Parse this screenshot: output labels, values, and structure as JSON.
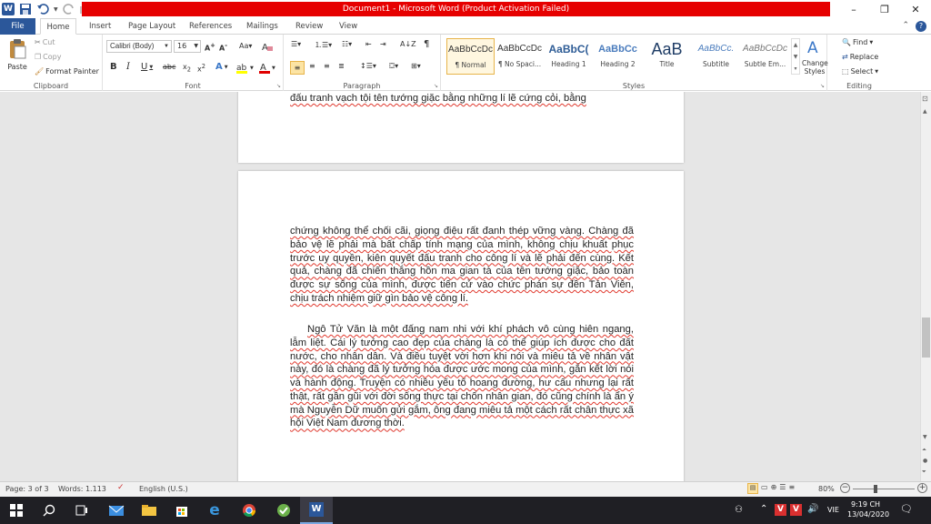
{
  "window": {
    "title": "Document1 - Microsoft Word (Product Activation Failed)",
    "minimize": "–",
    "restore": "❐",
    "close": "✕",
    "help": "?"
  },
  "tabs": [
    "File",
    "Home",
    "Insert",
    "Page Layout",
    "References",
    "Mailings",
    "Review",
    "View"
  ],
  "clipboard": {
    "paste": "Paste",
    "cut": "Cut",
    "copy": "Copy",
    "format_painter": "Format Painter",
    "label": "Clipboard"
  },
  "font": {
    "name": "Calibri (Body)",
    "size": "16",
    "label": "Font"
  },
  "paragraph": {
    "label": "Paragraph"
  },
  "styles": {
    "label": "Styles",
    "items": [
      {
        "preview": "AaBbCcDc",
        "name": "¶ Normal"
      },
      {
        "preview": "AaBbCcDc",
        "name": "¶ No Spaci..."
      },
      {
        "preview": "AaBbC(",
        "name": "Heading 1"
      },
      {
        "preview": "AaBbCc",
        "name": "Heading 2"
      },
      {
        "preview": "AaB",
        "name": "Title"
      },
      {
        "preview": "AaBbCc.",
        "name": "Subtitle"
      },
      {
        "preview": "AaBbCcDc",
        "name": "Subtle Em..."
      }
    ],
    "change_styles": "Change Styles"
  },
  "editing": {
    "find": "Find",
    "replace": "Replace",
    "select": "Select",
    "label": "Editing"
  },
  "document": {
    "page1_tail": "đấu tranh vạch tội tên tướng giặc bằng những lí lẽ cứng cỏi, bằng",
    "p1": "chứng không thể chối cãi, giọng điệu rất đanh thép vững vàng. Chàng đã bảo vệ lẽ phải mà bất chấp tính mạng của mình, không chịu khuất phục trước uy quyền, kiên quyết đấu tranh cho công lí và lẽ phải đến cùng. Kết quả, chàng đã chiến thắng hồn ma gian tà của tên tướng giặc, bảo toàn được sự sống của mình, được tiến cử vào chức phán sự đền Tản Viên, chịu trách nhiệm giữ gìn bảo vệ công lí.",
    "p2": "Ngô Tử Văn là một đấng nam nhi với khí phách vô cùng hiên ngang, lẫm liệt. Cái lý tưởng cao đẹp của chàng là có thể giúp ích được cho đất nước, cho nhân dân. Và điều tuyệt vời hơn khi nói và miêu tả về nhân vật này, đó là chàng đã lý tưởng hóa được ước mong của mình, gắn kết lời nói và hành động. Truyện có nhiều yếu tố hoang đường, hư cấu nhưng lại rất thật, rất gần gũi với đời sống thực tại chốn nhân gian, đó cũng chính là ẩn ý mà Nguyễn Dữ muốn gửi gắm, ông đang miêu tả một cách rất chân thực xã hội Việt Nam đương thời."
  },
  "status": {
    "page": "Page: 3 of 3",
    "words": "Words: 1.113",
    "language": "English (U.S.)",
    "zoom": "80%"
  },
  "taskbar": {
    "ime": "VIE",
    "time": "9:19 CH",
    "date": "13/04/2020",
    "notif": "1"
  }
}
